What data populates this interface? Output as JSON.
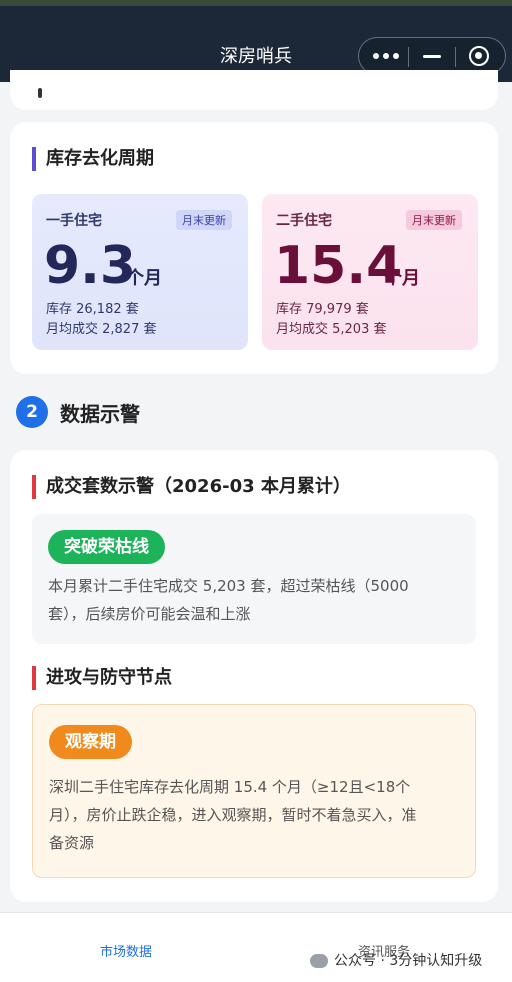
{
  "app": {
    "title": "深房哨兵"
  },
  "inventory": {
    "section_title": "库存去化周期",
    "new_home": {
      "label": "一手住宅",
      "badge": "月末更新",
      "value": "9.3",
      "unit": "个月",
      "stock": "库存 26,182 套",
      "monthly": "月均成交 2,827 套"
    },
    "second_home": {
      "label": "二手住宅",
      "badge": "月末更新",
      "value": "15.4",
      "unit": "个月",
      "stock": "库存 79,979 套",
      "monthly": "月均成交 5,203 套"
    }
  },
  "alerts": {
    "step_number": "2",
    "step_title": "数据示警",
    "deals": {
      "title": "成交套数示警（2026-03 本月累计）",
      "pill": "突破荣枯线",
      "text_line1": "本月累计二手住宅成交 5,203 套，超过荣枯线（5000",
      "text_line2": "套），后续房价可能会温和上涨"
    },
    "nodes": {
      "title": "进攻与防守节点",
      "pill": "观察期",
      "text_line1": "深圳二手住宅库存去化周期 15.4 个月（≥12且<18个",
      "text_line2": "月），房价止跌企稳，进入观察期，暂时不着急买入，准",
      "text_line3": "备资源"
    }
  },
  "tabbar": {
    "tab1": "市场数据",
    "tab2": "资讯服务",
    "watermark": "公众号 · 3分钟认知升级"
  },
  "colors": {
    "accent_blue": "#1f6fe8",
    "green_pill": "#1db35a",
    "orange_pill": "#f08a1c",
    "alert_red": "#e0383e"
  }
}
